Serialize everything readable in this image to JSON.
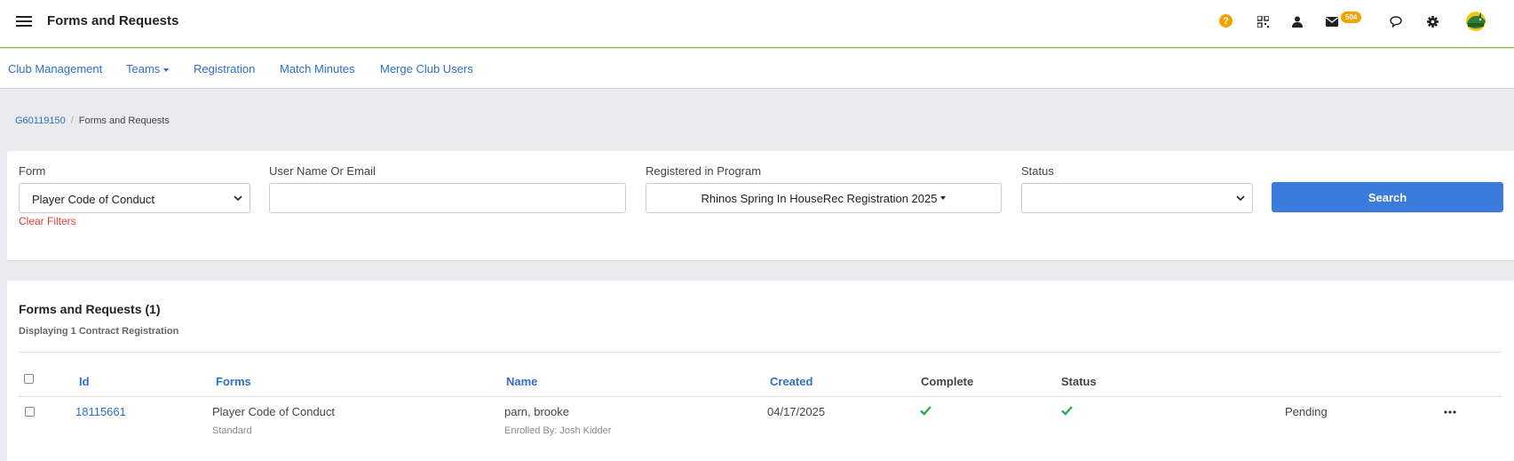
{
  "header": {
    "title": "Forms and Requests",
    "help_icon": "question-circle-icon",
    "help_glyph": "?",
    "icons": [
      "qr-code-icon",
      "user-icon",
      "envelope-icon",
      "chat-icon",
      "gear-icon"
    ],
    "mail_badge": "504",
    "accent_color": "#f4a100"
  },
  "nav": {
    "items": [
      {
        "label": "Club Management"
      },
      {
        "label": "Teams"
      },
      {
        "label": "Registration"
      },
      {
        "label": "Match Minutes"
      },
      {
        "label": "Merge Club Users"
      }
    ]
  },
  "breadcrumb": {
    "root": "G60119150",
    "separator": "/",
    "current": "Forms and Requests"
  },
  "filters": {
    "form_label": "Form",
    "form_value": "Player Code of Conduct",
    "user_label": "User Name Or Email",
    "user_value": "",
    "program_label": "Registered in Program",
    "program_value": "Rhinos Spring In HouseRec Registration 2025",
    "status_label": "Status",
    "status_value": "",
    "clear_label": "Clear Filters",
    "search_label": "Search"
  },
  "results": {
    "title": "Forms and Requests (1)",
    "subtitle": "Displaying 1 Contract Registration",
    "columns": {
      "id": "Id",
      "forms": "Forms",
      "name": "Name",
      "created": "Created",
      "complete": "Complete",
      "status": "Status"
    },
    "rows": [
      {
        "id": "18115661",
        "form": "Player Code of Conduct",
        "form_type": "Standard",
        "name": "parn, brooke",
        "enrolled_by": "Enrolled By: Josh Kidder",
        "created": "04/17/2025",
        "complete": true,
        "status_check": true,
        "state": "Pending"
      }
    ]
  },
  "colors": {
    "link": "#2c6fcc",
    "primary_button": "#3a7bdb",
    "danger": "#e53935",
    "success": "#2eaa45"
  }
}
